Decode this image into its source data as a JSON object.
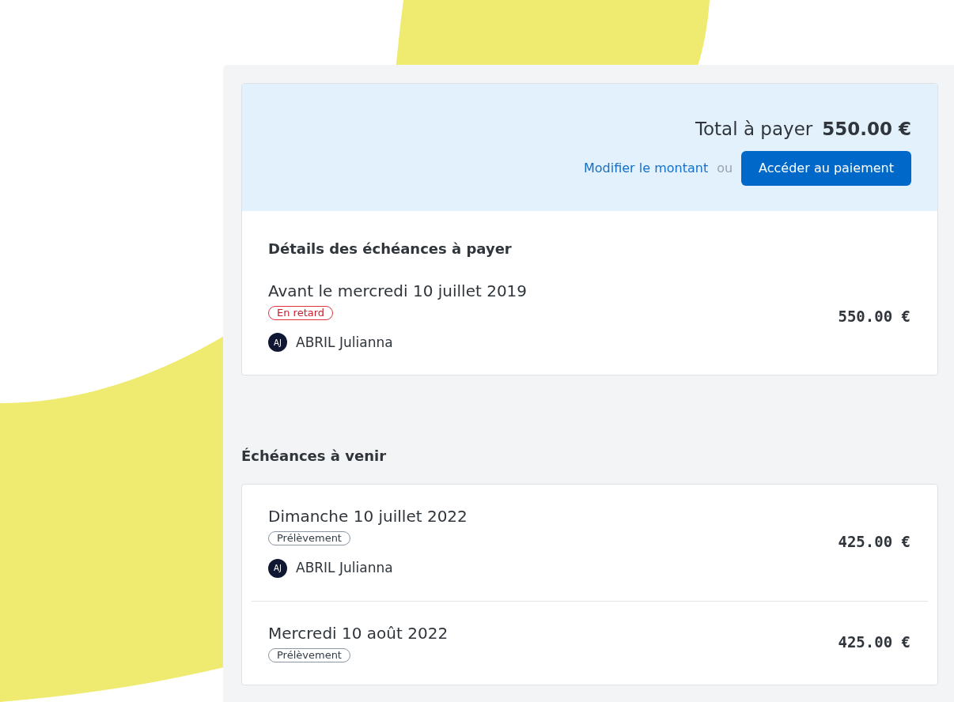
{
  "summary": {
    "total_label": "Total à payer",
    "total_amount": "550.00 €",
    "modify_link": "Modifier le montant",
    "separator": "ou",
    "pay_button": "Accéder au paiement"
  },
  "due": {
    "title": "Détails des échéances à payer",
    "items": [
      {
        "date": "Avant le mercredi 10 juillet 2019",
        "badge": {
          "kind": "late",
          "label": "En retard"
        },
        "amount": "550.00 €",
        "person": {
          "initials": "AJ",
          "name": "ABRIL Julianna"
        }
      }
    ]
  },
  "upcoming": {
    "title": "Échéances à venir",
    "items": [
      {
        "date": "Dimanche 10 juillet 2022",
        "badge": {
          "kind": "debit",
          "label": "Prélèvement"
        },
        "amount": "425.00 €",
        "person": {
          "initials": "AJ",
          "name": "ABRIL Julianna"
        }
      },
      {
        "date": "Mercredi 10 août 2022",
        "badge": {
          "kind": "debit",
          "label": "Prélèvement"
        },
        "amount": "425.00 €"
      }
    ]
  }
}
